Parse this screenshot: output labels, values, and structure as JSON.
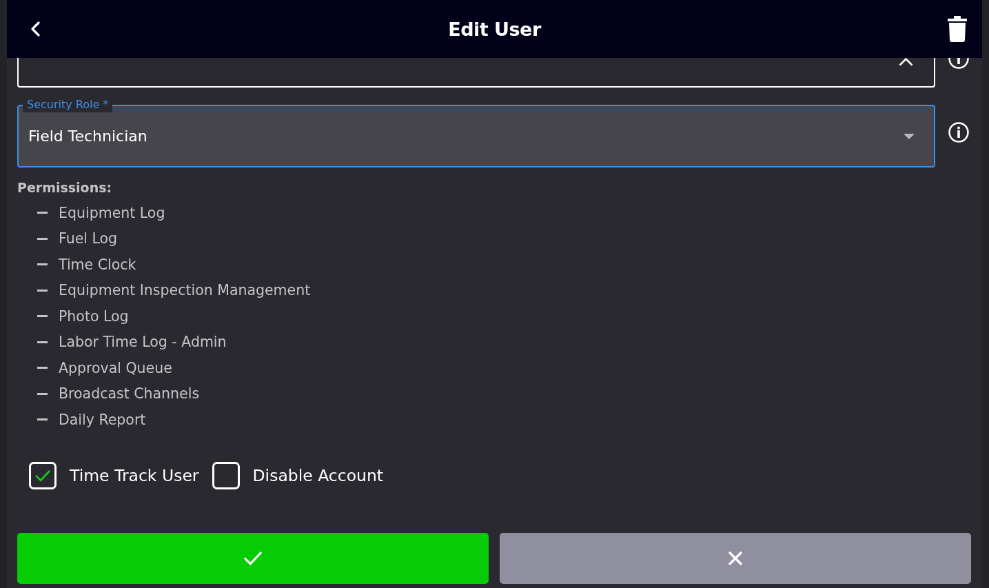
{
  "header": {
    "title": "Edit User"
  },
  "fields": [
    {
      "kind": "autocomplete",
      "expanded": true,
      "focused": false
    },
    {
      "kind": "select",
      "label": "Security Role *",
      "value": "Field Technician",
      "focused": true
    }
  ],
  "permissions": {
    "label": "Permissions:",
    "items": [
      "Equipment Log",
      "Fuel Log",
      "Time Clock",
      "Equipment Inspection Management",
      "Photo Log",
      "Labor Time Log - Admin",
      "Approval Queue",
      "Broadcast Channels",
      "Daily Report"
    ]
  },
  "checkboxes": [
    {
      "label": "Time Track User",
      "checked": true
    },
    {
      "label": "Disable Account",
      "checked": false
    }
  ],
  "actions": [
    {
      "kind": "confirm"
    },
    {
      "kind": "cancel"
    }
  ]
}
